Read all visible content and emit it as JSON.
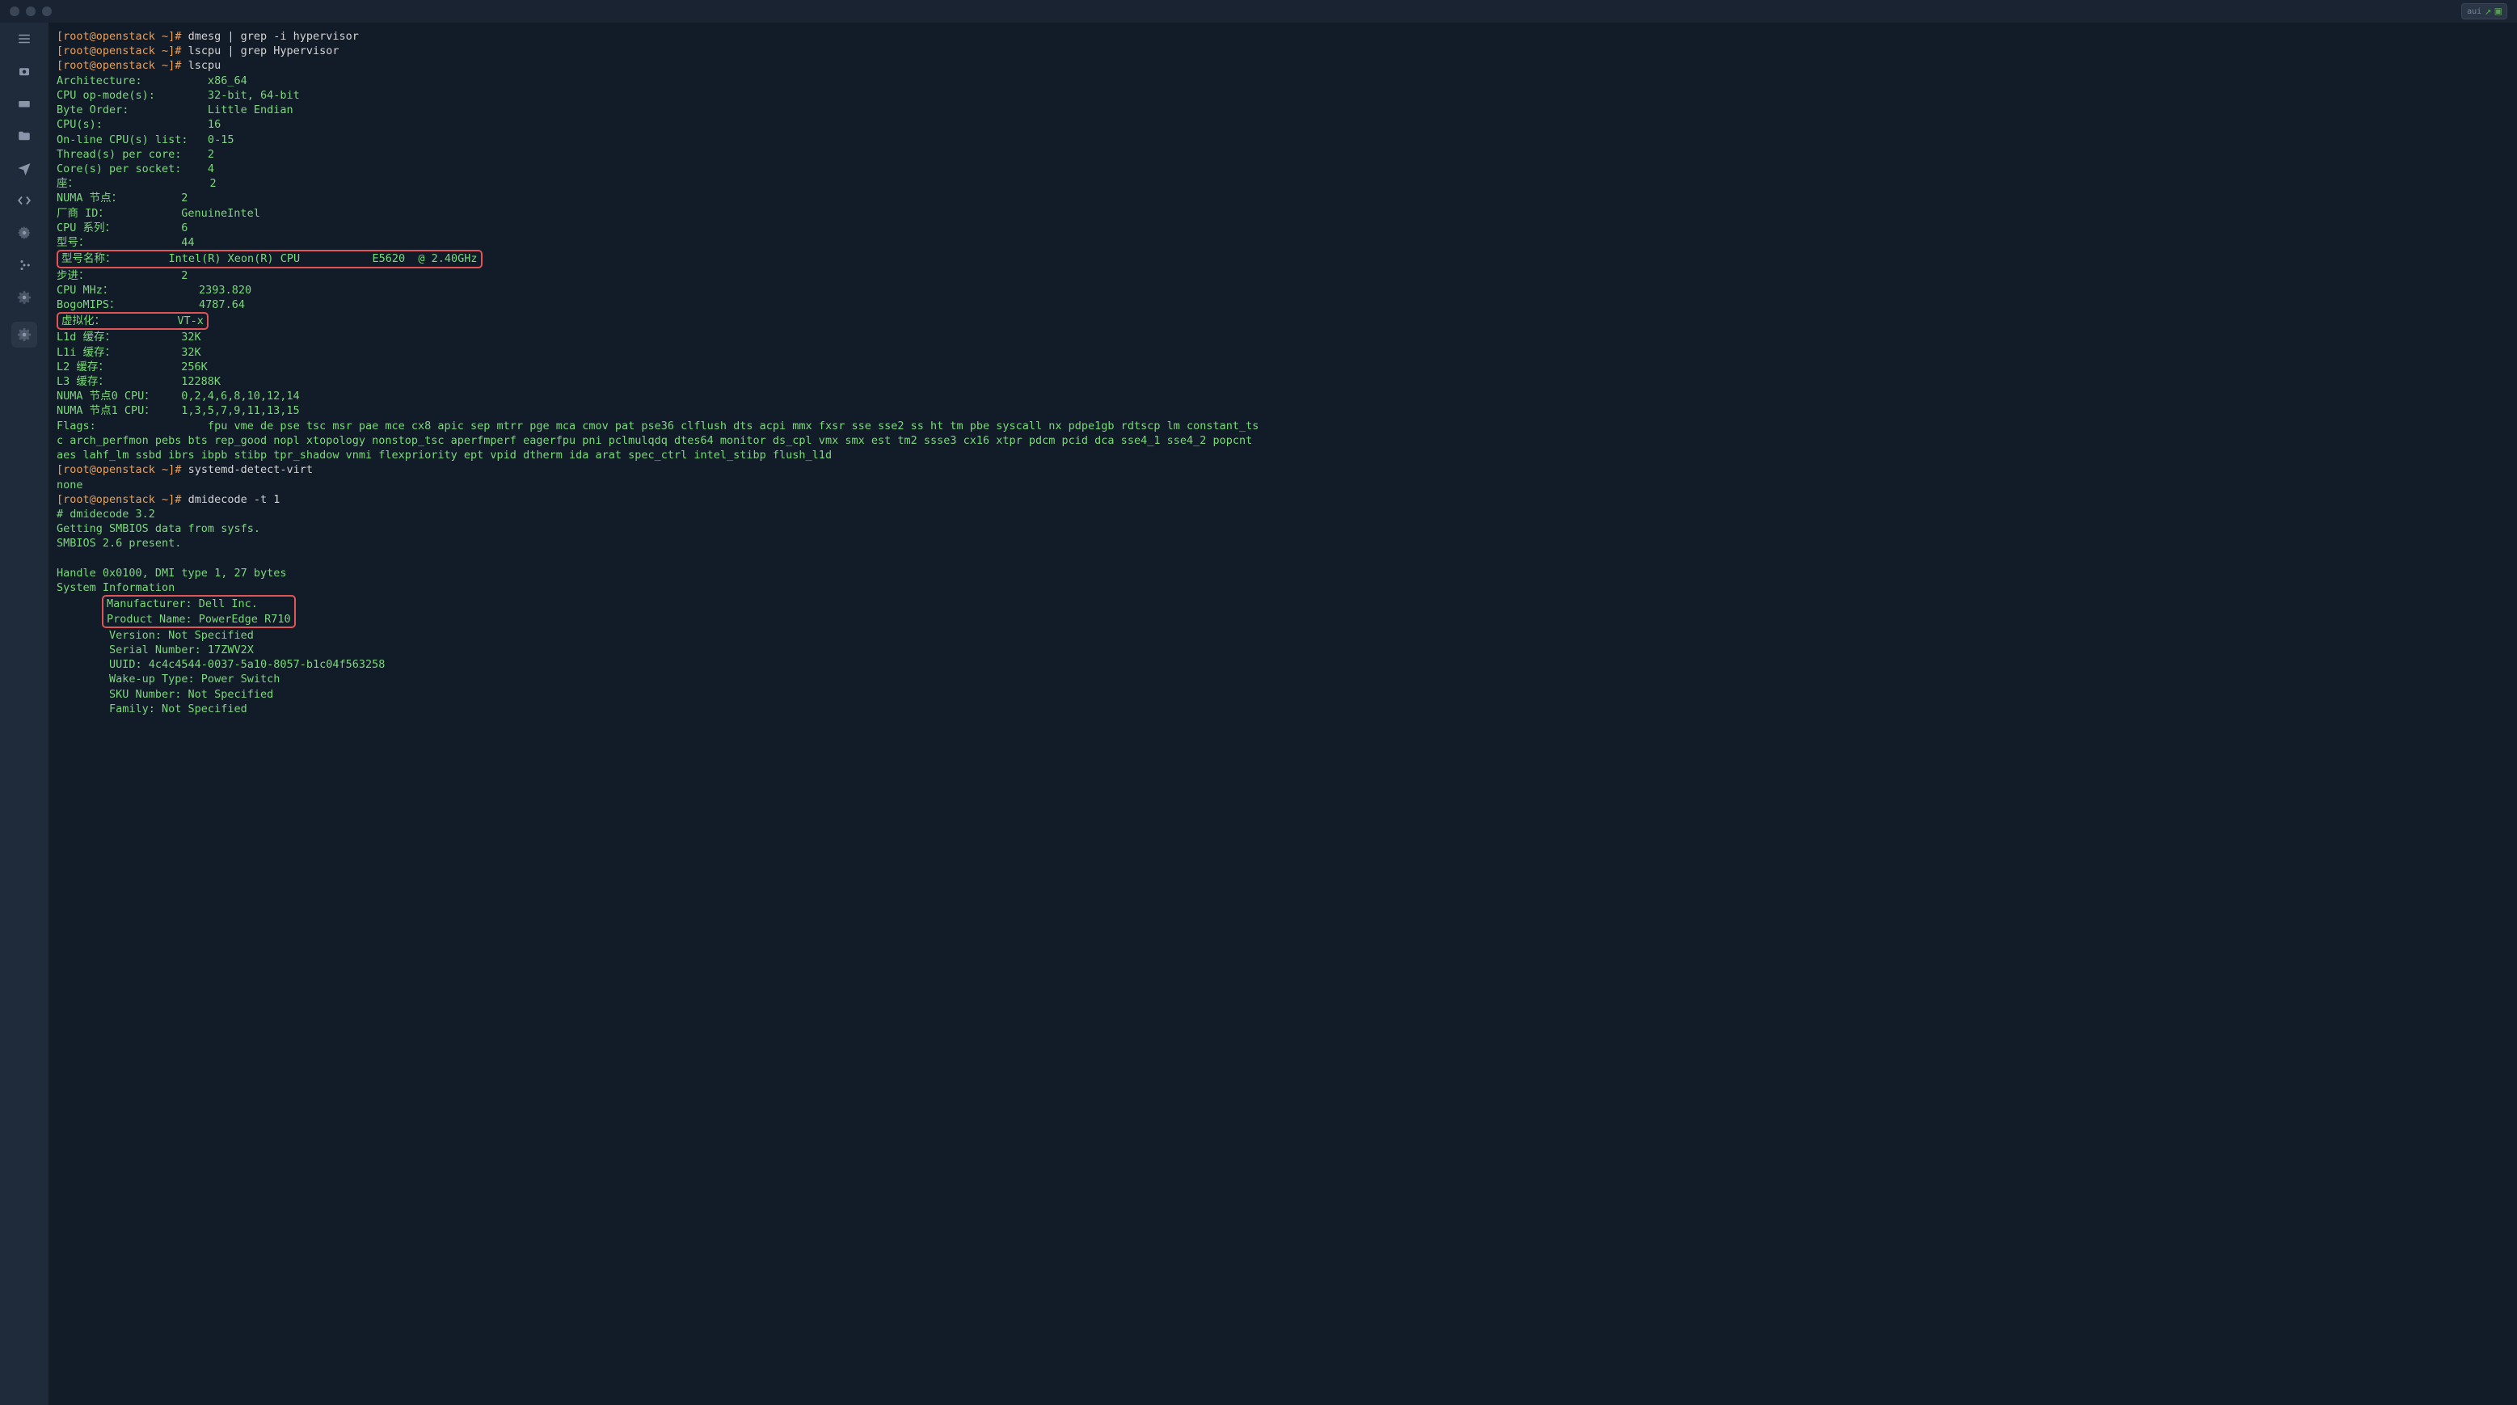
{
  "titlebar": {
    "badge_text": "aui"
  },
  "terminal": {
    "prompt1": "[root@openstack ~]# ",
    "cmd1": "dmesg | grep -i hypervisor",
    "prompt2": "[root@openstack ~]# ",
    "cmd2": "lscpu | grep Hypervisor",
    "prompt3": "[root@openstack ~]# ",
    "cmd3": "lscpu",
    "lscpu": {
      "arch": "Architecture:          x86_64",
      "opmode": "CPU op-mode(s):        32-bit, 64-bit",
      "byteorder": "Byte Order:            Little Endian",
      "cpus": "CPU(s):                16",
      "online": "On-line CPU(s) list:   0-15",
      "threads": "Thread(s) per core:    2",
      "cores": "Core(s) per socket:    4",
      "sockets": "座：                    2",
      "numa": "NUMA 节点：         2",
      "vendor": "厂商 ID：           GenuineIntel",
      "family": "CPU 系列：          6",
      "model": "型号：              44",
      "modelname": "型号名称：        Intel(R) Xeon(R) CPU           E5620  @ 2.40GHz",
      "stepping": "步进：              2",
      "mhz": "CPU MHz：             2393.820",
      "bogo": "BogoMIPS：            4787.64",
      "virt": "虚拟化：           VT-x",
      "l1d": "L1d 缓存：          32K",
      "l1i": "L1i 缓存：          32K",
      "l2": "L2 缓存：           256K",
      "l3": "L3 缓存：           12288K",
      "numa0": "NUMA 节点0 CPU：    0,2,4,6,8,10,12,14",
      "numa1": "NUMA 节点1 CPU：    1,3,5,7,9,11,13,15",
      "flags1": "Flags:                 fpu vme de pse tsc msr pae mce cx8 apic sep mtrr pge mca cmov pat pse36 clflush dts acpi mmx fxsr sse sse2 ss ht tm pbe syscall nx pdpe1gb rdtscp lm constant_ts",
      "flags2": "c arch_perfmon pebs bts rep_good nopl xtopology nonstop_tsc aperfmperf eagerfpu pni pclmulqdq dtes64 monitor ds_cpl vmx smx est tm2 ssse3 cx16 xtpr pdcm pcid dca sse4_1 sse4_2 popcnt",
      "flags3": "aes lahf_lm ssbd ibrs ibpb stibp tpr_shadow vnmi flexpriority ept vpid dtherm ida arat spec_ctrl intel_stibp flush_l1d"
    },
    "prompt4": "[root@openstack ~]# ",
    "cmd4": "systemd-detect-virt",
    "out4": "none",
    "prompt5": "[root@openstack ~]# ",
    "cmd5": "dmidecode -t 1",
    "dmi": {
      "header1": "# dmidecode 3.2",
      "header2": "Getting SMBIOS data from sysfs.",
      "header3": "SMBIOS 2.6 present.",
      "handle": "Handle 0x0100, DMI type 1, 27 bytes",
      "sysinfo": "System Information",
      "mfr": "        Manufacturer: Dell Inc.",
      "prod": "        Product Name: PowerEdge R710",
      "ver": "        Version: Not Specified",
      "serial": "        Serial Number: 17ZWV2X",
      "uuid": "        UUID: 4c4c4544-0037-5a10-8057-b1c04f563258",
      "wake": "        Wake-up Type: Power Switch",
      "sku": "        SKU Number: Not Specified",
      "fam": "        Family: Not Specified"
    }
  }
}
